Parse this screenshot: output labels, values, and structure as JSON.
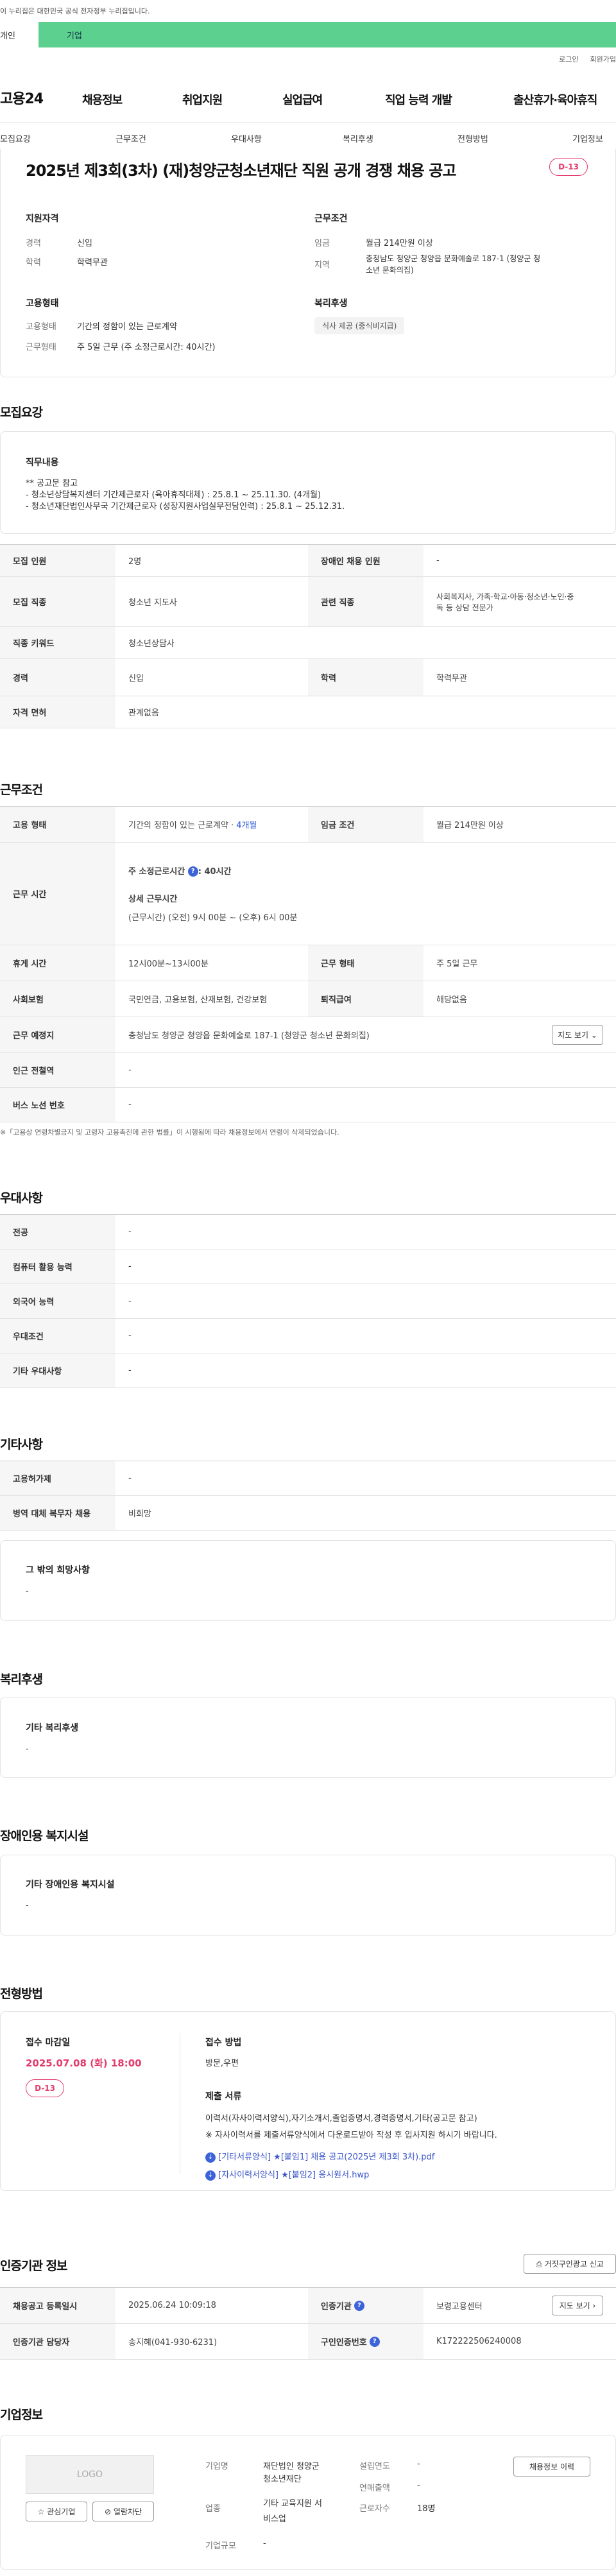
{
  "notice": "이 누리집은 대한민국 공식 전자정부 누리집입니다.",
  "tabs": [
    "개인",
    "기업"
  ],
  "util": [
    "로그인",
    "회원가입"
  ],
  "logo": "고용24",
  "gnb": [
    "채용정보",
    "취업지원",
    "실업급여",
    "직업 능력 개발",
    "출산휴가·육아휴직"
  ],
  "subnav": [
    "모집요강",
    "근무조건",
    "우대사항",
    "복리후생",
    "전형방법",
    "기업정보"
  ],
  "job": {
    "title": "2025년 제3회(3차) (재)청양군청소년재단 직원 공개 경쟁 채용 공고",
    "dday": "D-13",
    "req_h": "지원자격",
    "career_l": "경력",
    "career_v": "신입",
    "edu_l": "학력",
    "edu_v": "학력무관",
    "cond_h": "근무조건",
    "wage_l": "임금",
    "wage_v": "월급 214만원 이상",
    "area_l": "지역",
    "area_v1": "충청남도 청양군 청양읍 문화예술로 187-1 (청양군 청",
    "area_v2": "소년 문화의집)",
    "emp_h": "고용형태",
    "emptype_l": "고용형태",
    "emptype_v": "기간의 정함이 있는 근로계약",
    "worktype_l": "근무형태",
    "worktype_v": "주 5일 근무 (주 소정근로시간: 40시간)",
    "welfare_h": "복리후생",
    "welfare_tag": "식사 제공 (중식비지급)"
  },
  "recruit": {
    "h": "모집요강",
    "duty_h": "직무내용",
    "duty1": "** 공고문 참고",
    "duty2": "- 청소년상담복지센터 기간제근로자 (육아휴직대체) : 25.8.1 ~ 25.11.30. (4개월)",
    "duty3": "- 청소년재단법인사무국 기간제근로자 (성장지원사업실무전담인력) : 25.8.1 ~ 25.12.31.",
    "rows": [
      [
        "모집 인원",
        "2명",
        "장애인 채용 인원",
        "-"
      ],
      [
        "모집 직종",
        "청소년 지도사",
        "관련 직종",
        "사회복지사, 가족·학교·아동·청소년·노인·중",
        "독 등 상담 전문가"
      ],
      [
        "직종 키워드",
        "청소년상담사"
      ],
      [
        "경력",
        "신입",
        "학력",
        "학력무관"
      ],
      [
        "자격 면허",
        "관계없음"
      ]
    ]
  },
  "work": {
    "h": "근무조건",
    "type_l": "고용 형태",
    "type_v": "기간의 정함이 있는 근로계약 · ",
    "type_v2": "4개월",
    "wage_l": "임금 조건",
    "wage_v": "월급 214만원 이상",
    "time_l": "근무 시간",
    "time1": "주 소정근로시간 ",
    "time1b": ": 40시간",
    "time2": "상세 근무시간",
    "time3": "(근무시간) (오전) 9시 00분 ~ (오후) 6시 00분",
    "rest_l": "휴게 시간",
    "rest_v": "12시00분~13시00분",
    "form_l": "근무 형태",
    "form_v": "주 5일 근무",
    "ins_l": "사회보험",
    "ins_v": "국민연금, 고용보험, 산재보험, 건강보험",
    "sev_l": "퇴직급여",
    "sev_v": "해당없음",
    "place_l": "근무 예정지",
    "place_v": "충청남도 청양군 청양읍 문화예술로 187-1 (청양군 청소년 문화의집)",
    "map_btn": "지도 보기",
    "subway_l": "인근 전철역",
    "subway_v": "-",
    "bus_l": "버스 노선 번호",
    "bus_v": "-",
    "note": "※「고용상 연령차별금지 및 고령자 고용촉진에 관한 법률」이 시행됨에 따라 채용정보에서 연령이 삭제되었습니다."
  },
  "pref": {
    "h": "우대사항",
    "rows": [
      [
        "전공",
        "-"
      ],
      [
        "컴퓨터 활용 능력",
        "-"
      ],
      [
        "외국어 능력",
        "-"
      ],
      [
        "우대조건",
        "-"
      ],
      [
        "기타 우대사항",
        "-"
      ]
    ]
  },
  "etc": {
    "h": "기타사항",
    "rows": [
      [
        "고용허가제",
        "-"
      ],
      [
        "병역 대체 복무자 채용",
        "비희망"
      ]
    ],
    "wish_h": "그 밖의 희망사항",
    "wish_v": "-"
  },
  "welfare": {
    "h": "복리후생",
    "box_h": "기타 복리후생",
    "box_v": "-"
  },
  "disab": {
    "h": "장애인용 복지시설",
    "box_h": "기타 장애인용 복지시설",
    "box_v": "-"
  },
  "screen": {
    "h": "전형방법",
    "deadline_l": "접수 마감일",
    "deadline_v": "2025.07.08 (화) 18:00",
    "dday": "D-13",
    "method_h": "접수 방법",
    "method_v": "방문,우편",
    "docs_h": "제출 서류",
    "docs1": "이력서(자사이력서양식),자기소개서,졸업증명서,경력증명서,기타(공고문 참고)",
    "docs2": "※ 자사이력서를 제출서류양식에서 다운로드받아 작성 후 입사지원 하시기 바랍니다.",
    "file1": "[기타서류양식] ★[붙임1] 채용 공고(2025년 제3회 3차).pdf",
    "file2": "[자사이력서양식] ★[붙임2] 응시원서.hwp"
  },
  "cert": {
    "h": "인증기관 정보",
    "report_btn": "거짓구인광고 신고",
    "reg_l": "채용공고 등록일시",
    "reg_v": "2025.06.24 10:09:18",
    "org_l": "인증기관",
    "org_v": "보령고용센터",
    "map_btn": "지도 보기",
    "mgr_l": "인증기관 담당자",
    "mgr_v": "송지혜(041-930-6231)",
    "no_l": "구인인증번호",
    "no_v": "K172222506240008"
  },
  "company": {
    "h": "기업정보",
    "logo": "LOGO",
    "fav": "관심기업",
    "block": "열람차단",
    "name_l": "기업명",
    "name_v1": "재단법인 청양군",
    "name_v2": "청소년재단",
    "year_l": "설립연도",
    "year_v": "-",
    "info_btn": "채용정보 이력",
    "ind_l": "업종",
    "ind_v1": "기타 교육지원 서",
    "ind_v2": "비스업",
    "sales_l": "연매출액",
    "sales_v": "-",
    "emp_l": "근로자수",
    "emp_v": "18명",
    "size_l": "기업규모",
    "size_v": "-"
  }
}
